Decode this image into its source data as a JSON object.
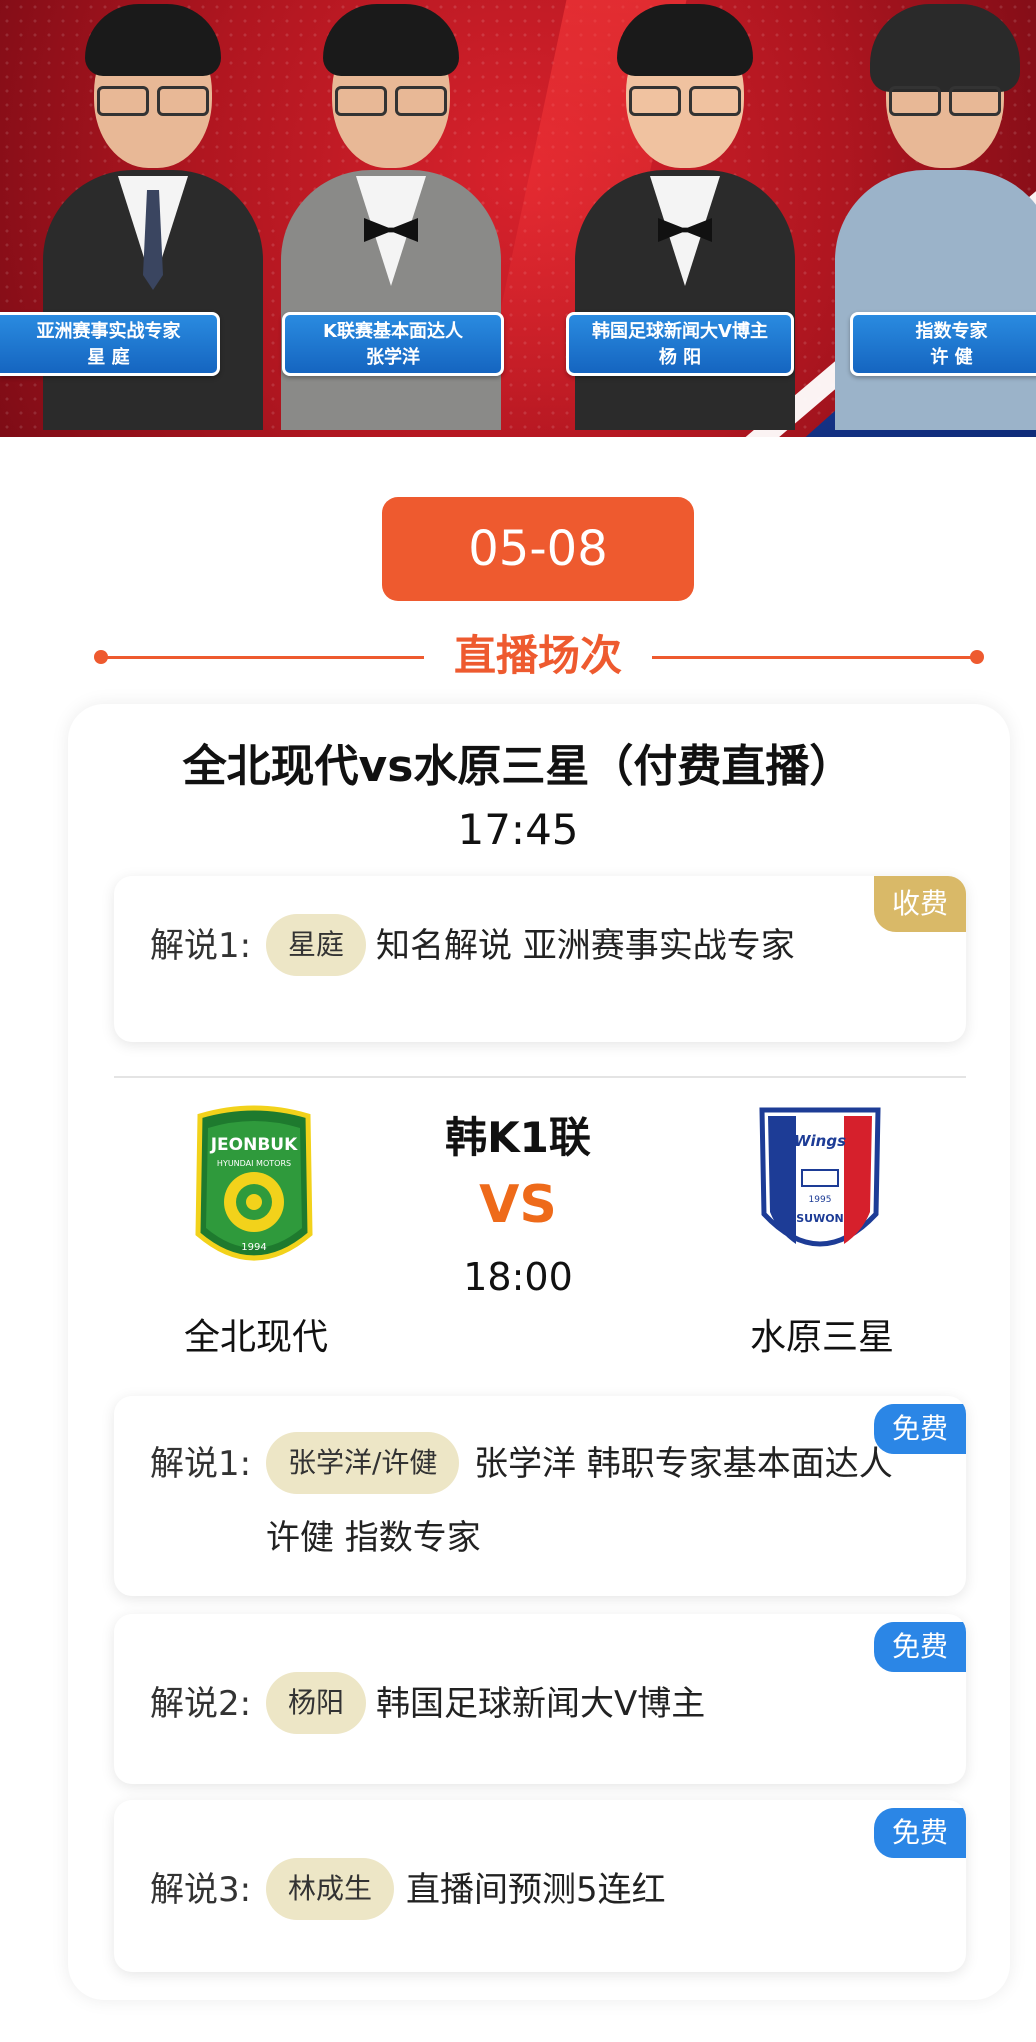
{
  "experts": [
    {
      "title": "亚洲赛事实战专家",
      "name": "星  庭"
    },
    {
      "title": "K联赛基本面达人",
      "name": "张学洋"
    },
    {
      "title": "韩国足球新闻大V博主",
      "name": "杨  阳"
    },
    {
      "title": "指数专家",
      "name": "许  健"
    }
  ],
  "date": "05-08",
  "section_title": "直播场次",
  "match1": {
    "title": "全北现代vs水原三星（付费直播）",
    "time": "17:45",
    "commentary": {
      "badge": "收费",
      "label": "解说1:",
      "name": "星庭",
      "desc": "知名解说 亚洲赛事实战专家"
    }
  },
  "match2": {
    "league": "韩K1联",
    "vs": "VS",
    "time": "18:00",
    "home": {
      "name": "全北现代",
      "crest_text": "JEONBUK",
      "crest_sub": "HYUNDAI MOTORS",
      "crest_year": "1994"
    },
    "away": {
      "name": "水原三星",
      "crest_text": "SUWON",
      "crest_brand": "Wings",
      "crest_year": "1995"
    },
    "commentary": [
      {
        "badge": "免费",
        "label": "解说1:",
        "name": "张学洋/许健",
        "desc": "张学洋 韩职专家基本面达人",
        "desc2": "许健 指数专家"
      },
      {
        "badge": "免费",
        "label": "解说2:",
        "name": "杨阳",
        "desc": "韩国足球新闻大V博主"
      },
      {
        "badge": "免费",
        "label": "解说3:",
        "name": "林成生",
        "desc": "直播间预测5连红"
      }
    ]
  },
  "colors": {
    "accent": "#ee5a2f",
    "vs": "#ee6a1a",
    "free_badge": "#2b86e6",
    "paid_badge": "#d9b968",
    "pill": "#ede6c6"
  }
}
